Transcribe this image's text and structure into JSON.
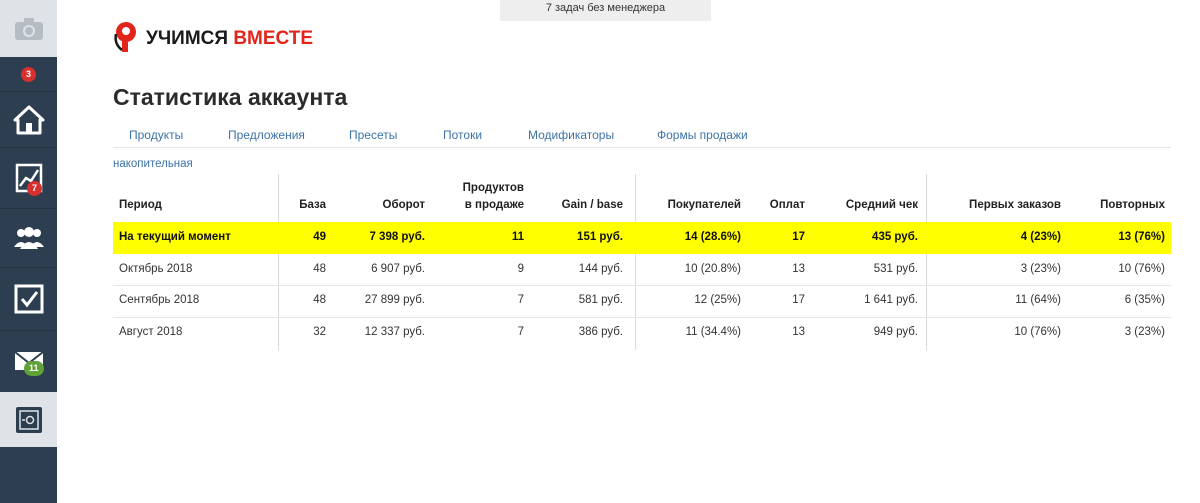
{
  "topbar": {
    "notice": "7 задач без менеджера"
  },
  "logo": {
    "word1": "УЧИМСЯ",
    "word2": "ВМЕСТЕ",
    "color_red": "#e1251b"
  },
  "sidebar": {
    "items": [
      {
        "icon": "camera-icon"
      },
      {
        "icon": "notification-icon",
        "badge": "3"
      },
      {
        "icon": "home-icon"
      },
      {
        "icon": "chart-icon",
        "badge": "7"
      },
      {
        "icon": "users-icon"
      },
      {
        "icon": "checkbox-icon"
      },
      {
        "icon": "mail-icon",
        "badge": "11"
      },
      {
        "icon": "safe-icon"
      }
    ]
  },
  "page": {
    "title": "Статистика аккаунта"
  },
  "tabs": [
    "Продукты",
    "Предложения",
    "Пресеты",
    "Потоки",
    "Модификаторы",
    "Формы продажи"
  ],
  "sublink": "накопительная",
  "table": {
    "headers": {
      "period": "Период",
      "base": "База",
      "turnover": "Оборот",
      "products_line1": "Продуктов",
      "products_line2": "в продаже",
      "gain": "Gain / base",
      "buyers": "Покупателей",
      "payments": "Оплат",
      "avg_check": "Средний чек",
      "first_orders": "Первых заказов",
      "repeat": "Повторных"
    },
    "rows": [
      {
        "period": "На текущий момент",
        "base": "49",
        "turnover": "7 398 руб.",
        "products": "11",
        "gain": "151 руб.",
        "buyers": "14 (28.6%)",
        "payments": "17",
        "avg_check": "435 руб.",
        "first_orders": "4 (23%)",
        "repeat": "13 (76%)"
      },
      {
        "period": "Октябрь 2018",
        "base": "48",
        "turnover": "6 907 руб.",
        "products": "9",
        "gain": "144 руб.",
        "buyers": "10 (20.8%)",
        "payments": "13",
        "avg_check": "531 руб.",
        "first_orders": "3 (23%)",
        "repeat": "10 (76%)"
      },
      {
        "period": "Сентябрь 2018",
        "base": "48",
        "turnover": "27 899 руб.",
        "products": "7",
        "gain": "581 руб.",
        "buyers": "12 (25%)",
        "payments": "17",
        "avg_check": "1 641 руб.",
        "first_orders": "11 (64%)",
        "repeat": "6 (35%)"
      },
      {
        "period": "Август 2018",
        "base": "32",
        "turnover": "12 337 руб.",
        "products": "7",
        "gain": "386 руб.",
        "buyers": "11 (34.4%)",
        "payments": "13",
        "avg_check": "949 руб.",
        "first_orders": "10 (76%)",
        "repeat": "3 (23%)"
      }
    ]
  },
  "colors": {
    "sidebar": "#2d3e50",
    "highlight": "#ffff00",
    "link": "#3c73a8"
  }
}
